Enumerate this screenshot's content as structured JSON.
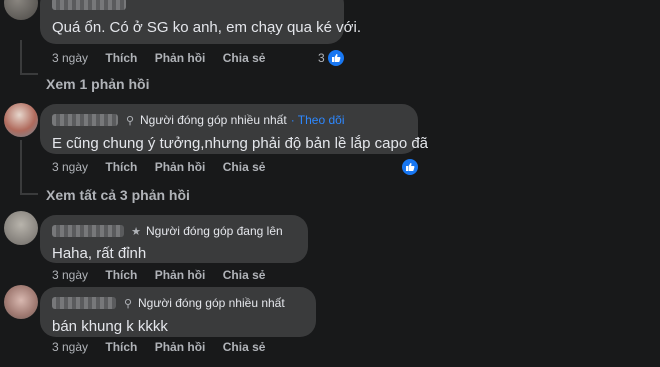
{
  "comments": [
    {
      "text": "Quá ổn. Có ở SG ko anh, em chạy qua ké với.",
      "actions": {
        "time": "3 ngày",
        "like": "Thích",
        "reply": "Phản hồi",
        "share": "Chia sẻ"
      },
      "reaction_count": "3",
      "reaction_icon": "like-icon",
      "replies_link": "Xem 1 phản hồi"
    },
    {
      "badge_icon": "contributor-icon",
      "badge": "Người đóng góp nhiều nhất",
      "follow": "· Theo dõi",
      "text": "E cũng chung ý tưởng,nhưng phải độ bản lề lắp capo đã",
      "actions": {
        "time": "3 ngày",
        "like": "Thích",
        "reply": "Phản hồi",
        "share": "Chia sẻ"
      },
      "reaction_icon": "like-icon",
      "replies_link": "Xem tất cả 3 phản hồi"
    },
    {
      "badge_icon": "star-icon",
      "badge": "Người đóng góp đang lên",
      "text": "Haha, rất đỉnh",
      "actions": {
        "time": "3 ngày",
        "like": "Thích",
        "reply": "Phản hồi",
        "share": "Chia sẻ"
      }
    },
    {
      "badge_icon": "contributor-icon",
      "badge": "Người đóng góp nhiều nhất",
      "text": "bán khung k kkkk",
      "actions": {
        "time": "3 ngày",
        "like": "Thích",
        "reply": "Phản hồi",
        "share": "Chia sẻ"
      }
    }
  ],
  "colors": {
    "background": "#18191a",
    "bubble": "#3a3b3c",
    "accent": "#2d88ff",
    "secondary_text": "#b0b3b8"
  }
}
